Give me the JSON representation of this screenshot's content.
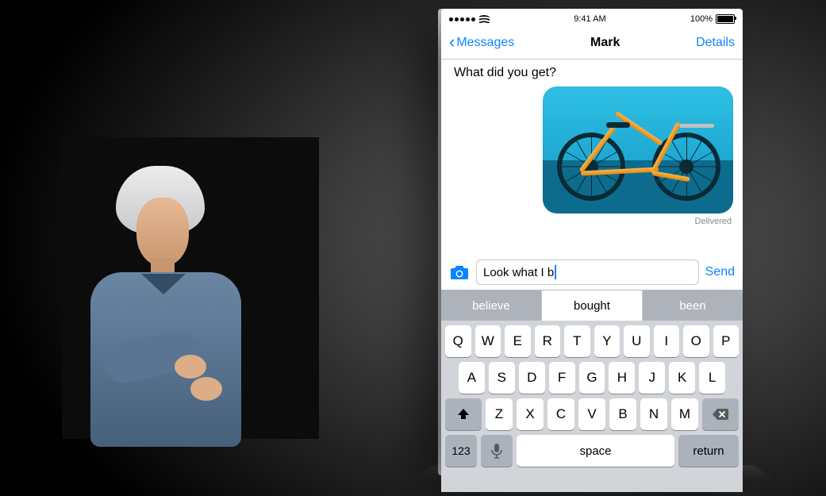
{
  "statusbar": {
    "time": "9:41 AM",
    "battery_pct": "100%"
  },
  "nav": {
    "back_label": "Messages",
    "title": "Mark",
    "details": "Details"
  },
  "thread": {
    "incoming": "What did you get?",
    "image_alt": "bicycle-photo",
    "delivered": "Delivered"
  },
  "compose": {
    "text": "Look what I b",
    "send": "Send"
  },
  "suggestions": [
    "believe",
    "bought",
    "been"
  ],
  "keyboard": {
    "row1": [
      "Q",
      "W",
      "E",
      "R",
      "T",
      "Y",
      "U",
      "I",
      "O",
      "P"
    ],
    "row2": [
      "A",
      "S",
      "D",
      "F",
      "G",
      "H",
      "J",
      "K",
      "L"
    ],
    "row3": [
      "Z",
      "X",
      "C",
      "V",
      "B",
      "N",
      "M"
    ],
    "mode": "123",
    "space": "space",
    "return": "return"
  }
}
